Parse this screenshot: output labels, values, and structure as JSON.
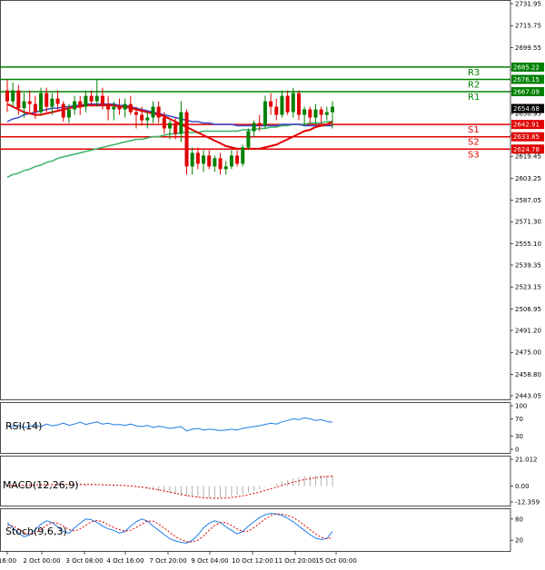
{
  "chart_data": {
    "type": "candlestick",
    "instrument_panel": {
      "y_ticks": [
        "2731.95",
        "2715.75",
        "2699.55",
        "2683.35",
        "2667.15",
        "2650.95",
        "2634.75",
        "2619.45",
        "2603.25",
        "2587.05",
        "2571.30",
        "2555.10",
        "2539.35",
        "2523.15",
        "2506.95",
        "2491.20",
        "2475.00",
        "2458.80",
        "2443.05"
      ],
      "ylim": [
        2443.05,
        2731.95
      ],
      "current_price": "2654.68",
      "levels": [
        {
          "name": "R3",
          "value": 2685.22,
          "label": "2685.22",
          "color": "#008000"
        },
        {
          "name": "R2",
          "value": 2676.15,
          "label": "2676.15",
          "color": "#008000"
        },
        {
          "name": "R1",
          "value": 2667.09,
          "label": "2667.09",
          "color": "#008000"
        },
        {
          "name": "S1",
          "value": 2642.91,
          "label": "2642.91",
          "color": "#e00000"
        },
        {
          "name": "S2",
          "value": 2633.85,
          "label": "2633.85",
          "color": "#e00000"
        },
        {
          "name": "S3",
          "value": 2624.78,
          "label": "2624.78",
          "color": "#e00000"
        }
      ],
      "candles": [
        [
          2668,
          2676,
          2652,
          2660
        ],
        [
          2660,
          2674,
          2656,
          2668
        ],
        [
          2668,
          2672,
          2650,
          2655
        ],
        [
          2655,
          2666,
          2648,
          2660
        ],
        [
          2660,
          2668,
          2652,
          2658
        ],
        [
          2658,
          2664,
          2647,
          2652
        ],
        [
          2652,
          2670,
          2650,
          2666
        ],
        [
          2666,
          2670,
          2652,
          2656
        ],
        [
          2656,
          2666,
          2650,
          2662
        ],
        [
          2662,
          2668,
          2654,
          2658
        ],
        [
          2658,
          2660,
          2645,
          2648
        ],
        [
          2648,
          2658,
          2644,
          2654
        ],
        [
          2654,
          2664,
          2650,
          2660
        ],
        [
          2660,
          2664,
          2650,
          2656
        ],
        [
          2656,
          2668,
          2652,
          2664
        ],
        [
          2664,
          2668,
          2656,
          2660
        ],
        [
          2660,
          2676,
          2656,
          2664
        ],
        [
          2664,
          2670,
          2654,
          2658
        ],
        [
          2658,
          2664,
          2646,
          2654
        ],
        [
          2654,
          2660,
          2646,
          2656
        ],
        [
          2656,
          2662,
          2650,
          2654
        ],
        [
          2654,
          2662,
          2648,
          2658
        ],
        [
          2658,
          2664,
          2650,
          2652
        ],
        [
          2652,
          2656,
          2640,
          2650
        ],
        [
          2650,
          2656,
          2642,
          2646
        ],
        [
          2646,
          2652,
          2640,
          2648
        ],
        [
          2648,
          2660,
          2644,
          2656
        ],
        [
          2656,
          2660,
          2644,
          2648
        ],
        [
          2648,
          2652,
          2636,
          2640
        ],
        [
          2640,
          2646,
          2632,
          2644
        ],
        [
          2644,
          2648,
          2632,
          2636
        ],
        [
          2636,
          2660,
          2630,
          2652
        ],
        [
          2652,
          2654,
          2606,
          2612
        ],
        [
          2612,
          2626,
          2606,
          2622
        ],
        [
          2622,
          2626,
          2610,
          2614
        ],
        [
          2614,
          2624,
          2608,
          2620
        ],
        [
          2620,
          2624,
          2610,
          2612
        ],
        [
          2612,
          2620,
          2608,
          2618
        ],
        [
          2618,
          2622,
          2606,
          2610
        ],
        [
          2610,
          2616,
          2606,
          2612
        ],
        [
          2612,
          2624,
          2610,
          2620
        ],
        [
          2620,
          2624,
          2612,
          2614
        ],
        [
          2614,
          2628,
          2612,
          2626
        ],
        [
          2626,
          2640,
          2624,
          2638
        ],
        [
          2638,
          2646,
          2634,
          2644
        ],
        [
          2644,
          2650,
          2638,
          2642
        ],
        [
          2642,
          2664,
          2640,
          2660
        ],
        [
          2660,
          2666,
          2650,
          2656
        ],
        [
          2656,
          2662,
          2646,
          2650
        ],
        [
          2650,
          2668,
          2648,
          2664
        ],
        [
          2664,
          2668,
          2650,
          2652
        ],
        [
          2652,
          2670,
          2648,
          2666
        ],
        [
          2666,
          2668,
          2646,
          2650
        ],
        [
          2650,
          2656,
          2642,
          2654
        ],
        [
          2654,
          2656,
          2644,
          2648
        ],
        [
          2648,
          2658,
          2644,
          2654
        ],
        [
          2654,
          2656,
          2644,
          2650
        ],
        [
          2650,
          2656,
          2646,
          2652
        ],
        [
          2652,
          2660,
          2640,
          2656
        ]
      ],
      "ma_red": [
        2658,
        2656,
        2654,
        2652,
        2651,
        2650,
        2650,
        2651,
        2652,
        2653,
        2654,
        2655,
        2656,
        2656,
        2657,
        2657,
        2657,
        2657,
        2657,
        2657,
        2656,
        2656,
        2655,
        2654,
        2653,
        2652,
        2651,
        2650,
        2649,
        2647,
        2645,
        2643,
        2641,
        2639,
        2637,
        2635,
        2633,
        2631,
        2629,
        2627,
        2626,
        2625,
        2625,
        2625,
        2625,
        2625,
        2626,
        2627,
        2628,
        2630,
        2632,
        2634,
        2636,
        2638,
        2639,
        2641,
        2642,
        2643,
        2645
      ],
      "ma_blue": [
        2645,
        2647,
        2648,
        2650,
        2651,
        2652,
        2653,
        2654,
        2655,
        2655,
        2656,
        2656,
        2657,
        2657,
        2658,
        2658,
        2658,
        2658,
        2658,
        2658,
        2657,
        2657,
        2656,
        2655,
        2654,
        2653,
        2652,
        2651,
        2650,
        2649,
        2648,
        2647,
        2646,
        2645,
        2645,
        2644,
        2644,
        2643,
        2643,
        2643,
        2643,
        2642,
        2642,
        2642,
        2642,
        2642,
        2642,
        2642,
        2642,
        2643,
        2643,
        2643,
        2643,
        2642,
        2642,
        2642,
        2642,
        2642,
        2642
      ],
      "ma_green": [
        2604,
        2606,
        2607,
        2609,
        2610,
        2612,
        2613,
        2615,
        2616,
        2618,
        2619,
        2620,
        2621,
        2622,
        2623,
        2624,
        2625,
        2626,
        2627,
        2628,
        2629,
        2630,
        2631,
        2632,
        2632,
        2633,
        2634,
        2634,
        2635,
        2636,
        2636,
        2637,
        2637,
        2637,
        2637,
        2638,
        2638,
        2638,
        2638,
        2638,
        2638,
        2638,
        2639,
        2639,
        2639,
        2640,
        2640,
        2641,
        2641,
        2642,
        2642,
        2643,
        2643,
        2643,
        2644,
        2644,
        2644,
        2645,
        2645
      ]
    },
    "rsi": {
      "label": "RSI(14)",
      "y_ticks": [
        "100",
        "70",
        "30",
        "0"
      ],
      "ylim": [
        0,
        100
      ],
      "values": [
        54,
        52,
        55,
        50,
        53,
        56,
        52,
        58,
        54,
        56,
        60,
        55,
        58,
        62,
        57,
        60,
        63,
        58,
        60,
        56,
        57,
        55,
        58,
        54,
        52,
        55,
        50,
        53,
        51,
        48,
        50,
        52,
        42,
        46,
        48,
        44,
        46,
        45,
        43,
        44,
        46,
        44,
        48,
        50,
        52,
        54,
        57,
        60,
        58,
        63,
        66,
        70,
        68,
        72,
        70,
        66,
        68,
        64,
        62
      ]
    },
    "macd": {
      "label": "MACD(12,26,9)",
      "y_ticks": [
        "21.012",
        "0.00",
        "-12.359"
      ],
      "ylim": [
        -12.359,
        21.012
      ],
      "histogram": [
        0.3,
        0.5,
        0.6,
        0.8,
        1.0,
        1.1,
        1.2,
        1.3,
        1.4,
        1.4,
        1.5,
        1.5,
        1.4,
        1.4,
        1.3,
        1.2,
        1.1,
        1.0,
        0.8,
        0.6,
        0.3,
        0.0,
        -0.4,
        -0.9,
        -1.5,
        -2.2,
        -3.0,
        -3.9,
        -4.8,
        -5.7,
        -6.5,
        -7.3,
        -8.0,
        -8.6,
        -9.0,
        -9.3,
        -9.4,
        -9.3,
        -9.0,
        -8.5,
        -7.8,
        -7.0,
        -6.0,
        -4.9,
        -3.6,
        -2.2,
        -0.8,
        0.7,
        2.1,
        3.5,
        4.8,
        5.9,
        6.9,
        7.6,
        8.1,
        8.4,
        8.5,
        8.4,
        8.2
      ],
      "signal": [
        0.2,
        0.4,
        0.6,
        0.7,
        0.9,
        1.0,
        1.1,
        1.2,
        1.3,
        1.3,
        1.4,
        1.4,
        1.4,
        1.4,
        1.3,
        1.3,
        1.2,
        1.1,
        1.0,
        0.8,
        0.6,
        0.4,
        0.1,
        -0.3,
        -0.8,
        -1.4,
        -2.1,
        -2.9,
        -3.8,
        -4.7,
        -5.6,
        -6.5,
        -7.3,
        -8.0,
        -8.6,
        -9.1,
        -9.4,
        -9.5,
        -9.5,
        -9.3,
        -8.9,
        -8.3,
        -7.6,
        -6.7,
        -5.7,
        -4.6,
        -3.4,
        -2.1,
        -0.8,
        0.5,
        1.8,
        3.0,
        4.1,
        5.1,
        5.9,
        6.6,
        7.1,
        7.5,
        7.7
      ]
    },
    "stoch": {
      "label": "Stoch(9,6,3)",
      "y_ticks": [
        "80",
        "20"
      ],
      "ylim": [
        0,
        100
      ],
      "k": [
        70,
        55,
        40,
        30,
        35,
        50,
        65,
        75,
        70,
        58,
        45,
        40,
        55,
        68,
        80,
        78,
        70,
        60,
        52,
        48,
        40,
        45,
        60,
        72,
        80,
        74,
        60,
        48,
        36,
        24,
        18,
        14,
        12,
        20,
        35,
        55,
        68,
        75,
        70,
        58,
        48,
        38,
        45,
        60,
        72,
        84,
        92,
        96,
        94,
        90,
        82,
        72,
        60,
        48,
        36,
        26,
        22,
        25,
        45
      ],
      "d": [
        62,
        60,
        52,
        42,
        36,
        40,
        50,
        62,
        70,
        68,
        60,
        50,
        46,
        52,
        62,
        72,
        76,
        72,
        64,
        56,
        50,
        46,
        48,
        56,
        66,
        74,
        74,
        66,
        54,
        42,
        30,
        22,
        16,
        15,
        20,
        32,
        48,
        62,
        70,
        70,
        62,
        52,
        44,
        46,
        56,
        68,
        80,
        90,
        94,
        94,
        90,
        84,
        74,
        62,
        50,
        38,
        28,
        24,
        28
      ]
    },
    "x_ticks": [
      "16:00",
      "2 Oct 00:00",
      "3 Oct 08:00",
      "4 Oct 16:00",
      "7 Oct 20:00",
      "9 Oct 04:00",
      "10 Oct 12:00",
      "11 Oct 20:00",
      "15 Oct 00:00"
    ],
    "colors": {
      "bull": "#008000",
      "bear": "#e00000",
      "rsi": "#1e7be6",
      "ma_red": "#e00000",
      "ma_blue": "#3c4ccc",
      "ma_green": "#3cb464",
      "macd_signal": "#e00000",
      "macd_hist": "#b0b0b0",
      "stoch_k": "#1e7be6",
      "stoch_d": "#e00000",
      "level_label_bg_green": "#008000",
      "level_label_bg_red": "#e00000",
      "price_tag_bg": "#000000"
    }
  }
}
